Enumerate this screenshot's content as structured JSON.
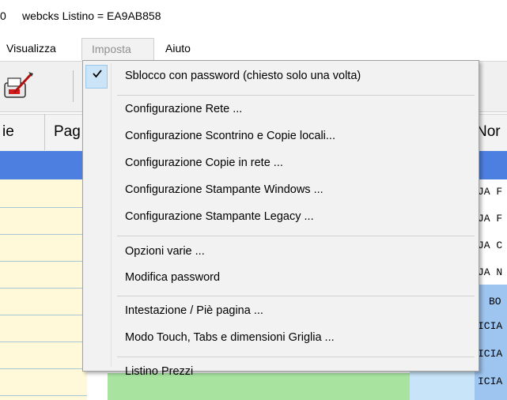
{
  "window": {
    "title_prefix": "0",
    "title": "webcks Listino = EA9AB858"
  },
  "menubar": {
    "items": [
      {
        "label": "Visualizza"
      },
      {
        "label": "Imposta"
      },
      {
        "label": "Aiuto"
      }
    ]
  },
  "grid": {
    "headers": {
      "col1": "ie",
      "col2": "Pag",
      "col3": "Nor"
    },
    "right_cells": [
      "JA F",
      "JA F",
      "JA C",
      "JA N",
      "BO",
      "ICIA",
      "ICIA",
      "ICIA"
    ]
  },
  "imposta_menu": {
    "items": [
      {
        "label": "Sblocco con password (chiesto solo una volta)",
        "checked": true
      },
      {
        "label": "Configurazione Rete ..."
      },
      {
        "label": "Configurazione Scontrino e Copie locali..."
      },
      {
        "label": "Configurazione Copie in rete ..."
      },
      {
        "label": "Configurazione Stampante Windows ..."
      },
      {
        "label": "Configurazione Stampante Legacy ..."
      },
      {
        "label": "Opzioni varie ..."
      },
      {
        "label": "Modifica password"
      },
      {
        "label": "Intestazione / Piè pagina ..."
      },
      {
        "label": "Modo Touch, Tabs e dimensioni Griglia ..."
      },
      {
        "label": "Listino Prezzi"
      }
    ]
  },
  "icons": {
    "checkmark": "check-icon",
    "toolbar_tool": "print-edit-icon"
  },
  "colors": {
    "selection": "#4d7fe0",
    "row_yellow": "#fff9d9",
    "row_green": "#a8e4a0",
    "row_blue": "#c8e4f8",
    "menu_bg": "#f2f2f2"
  }
}
